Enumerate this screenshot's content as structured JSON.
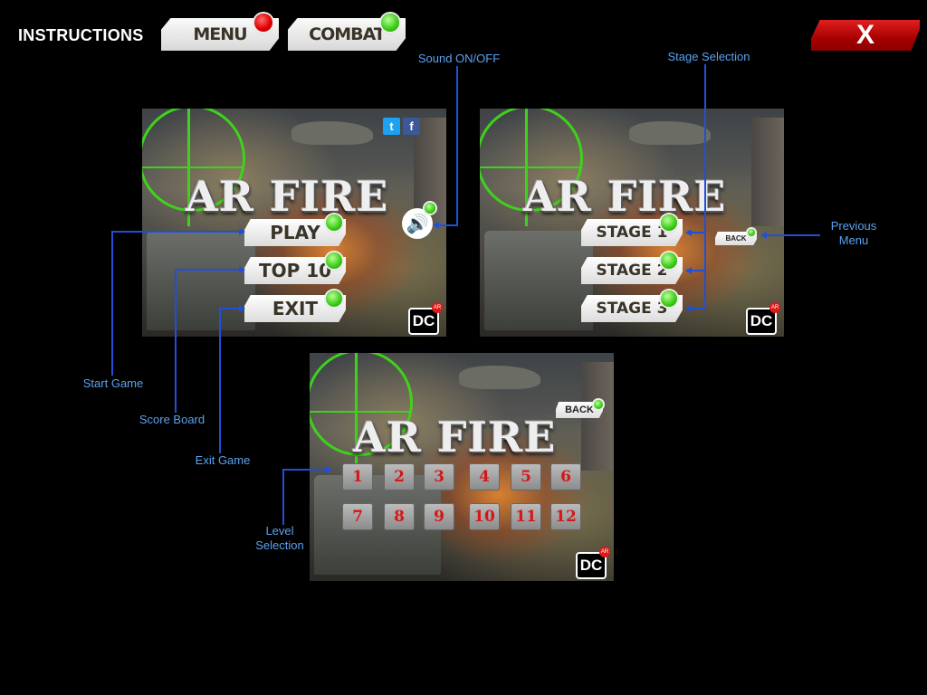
{
  "header": {
    "title": "INSTRUCTIONS",
    "tabs": [
      {
        "label": "MENU",
        "indicator": "red"
      },
      {
        "label": "COMBAT",
        "indicator": "green"
      }
    ],
    "close_label": "X"
  },
  "colors": {
    "label": "#5aa2f0",
    "leader": "#2050d8",
    "close": "#c00000",
    "indicator_green": "#3fcf1a",
    "indicator_red": "#e00000",
    "level_number": "#d41616"
  },
  "screens": {
    "main_menu": {
      "logo": "AR FIRE",
      "buttons": [
        "PLAY",
        "TOP 10",
        "EXIT"
      ],
      "social": {
        "twitter": "t",
        "facebook": "f"
      },
      "sound_icon": "🔊",
      "badge": {
        "text": "DC",
        "sup": "AR"
      }
    },
    "stage_menu": {
      "logo": "AR FIRE",
      "buttons": [
        "STAGE 1",
        "STAGE 2",
        "STAGE 3"
      ],
      "back": "BACK",
      "badge": {
        "text": "DC",
        "sup": "AR"
      }
    },
    "level_menu": {
      "logo": "AR FIRE",
      "back": "BACK",
      "levels": [
        "1",
        "2",
        "3",
        "4",
        "5",
        "6",
        "7",
        "8",
        "9",
        "10",
        "11",
        "12"
      ],
      "badge": {
        "text": "DC",
        "sup": "AR"
      }
    }
  },
  "annotations": {
    "sound": "Sound ON/OFF",
    "stage_selection": "Stage Selection",
    "previous_menu_1": "Previous",
    "previous_menu_2": "Menu",
    "start_game": "Start Game",
    "score_board": "Score Board",
    "exit_game": "Exit Game",
    "level_selection_1": "Level",
    "level_selection_2": "Selection"
  }
}
